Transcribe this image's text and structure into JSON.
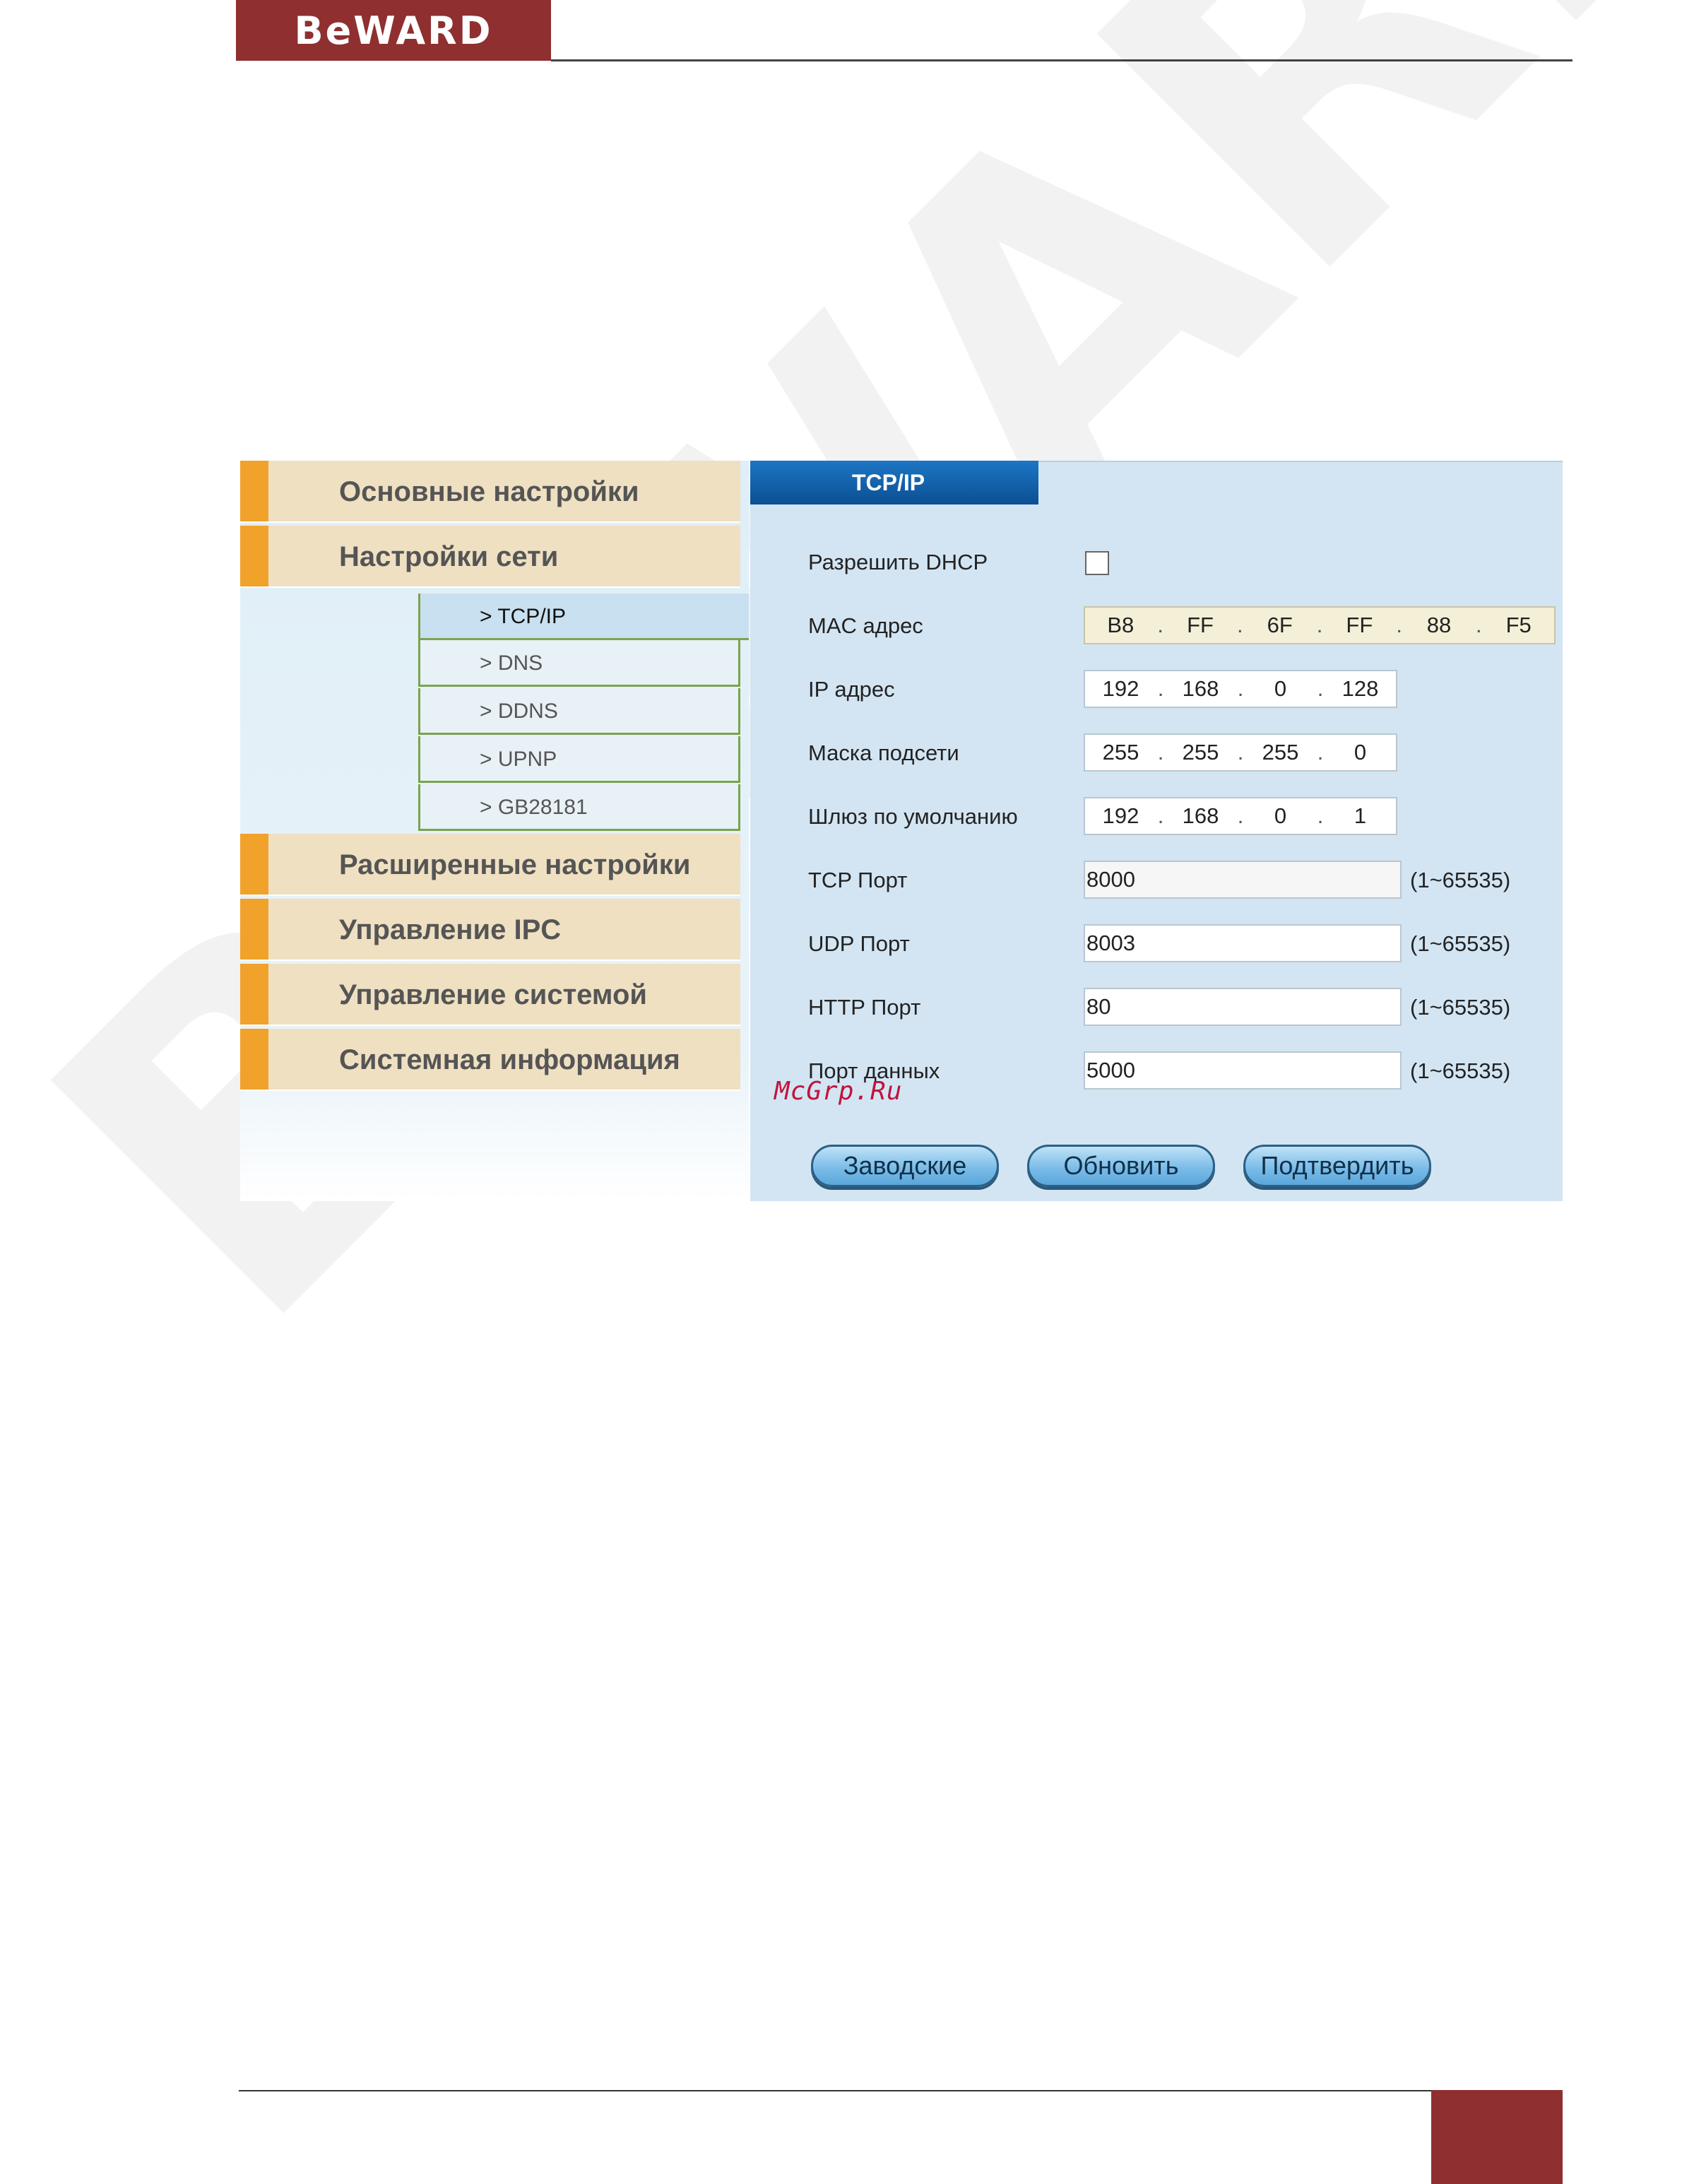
{
  "doc": {
    "brand": "BeWARD",
    "watermark": "BeWARD",
    "site_mark": "McGrp.Ru"
  },
  "sidebar": {
    "items": [
      {
        "label": "Основные настройки"
      },
      {
        "label": "Настройки сети"
      },
      {
        "label": "Расширенные настройки"
      },
      {
        "label": "Управление IPC"
      },
      {
        "label": "Управление системой"
      },
      {
        "label": "Системная информация"
      }
    ],
    "subitems": [
      {
        "label": "> TCP/IP"
      },
      {
        "label": "> DNS"
      },
      {
        "label": "> DDNS"
      },
      {
        "label": "> UPNP"
      },
      {
        "label": "> GB28181"
      }
    ]
  },
  "form": {
    "tab_title": "TCP/IP",
    "dhcp": {
      "label": "Разрешить DHCP",
      "checked": false
    },
    "mac": {
      "label": "MAC адрес",
      "octets": [
        "B8",
        "FF",
        "6F",
        "FF",
        "88",
        "F5"
      ]
    },
    "ip": {
      "label": "IP адрес",
      "octets": [
        "192",
        "168",
        "0",
        "128"
      ]
    },
    "mask": {
      "label": "Маска подсети",
      "octets": [
        "255",
        "255",
        "255",
        "0"
      ]
    },
    "gateway": {
      "label": "Шлюз по умолчанию",
      "octets": [
        "192",
        "168",
        "0",
        "1"
      ]
    },
    "tcp_port": {
      "label": "TCP Порт",
      "value": "8000",
      "range": "(1~65535)"
    },
    "udp_port": {
      "label": "UDP Порт",
      "value": "8003",
      "range": "(1~65535)"
    },
    "http_port": {
      "label": "HTTP Порт",
      "value": "80",
      "range": "(1~65535)"
    },
    "data_port": {
      "label": "Порт данных",
      "value": "5000",
      "range": "(1~65535)"
    },
    "buttons": {
      "factory": "Заводские",
      "refresh": "Обновить",
      "confirm": "Подтвердить"
    }
  },
  "colors": {
    "brand": "#8f2f2f",
    "menu_accent": "#f0a22a",
    "tab_blue": "#0c4f93"
  }
}
